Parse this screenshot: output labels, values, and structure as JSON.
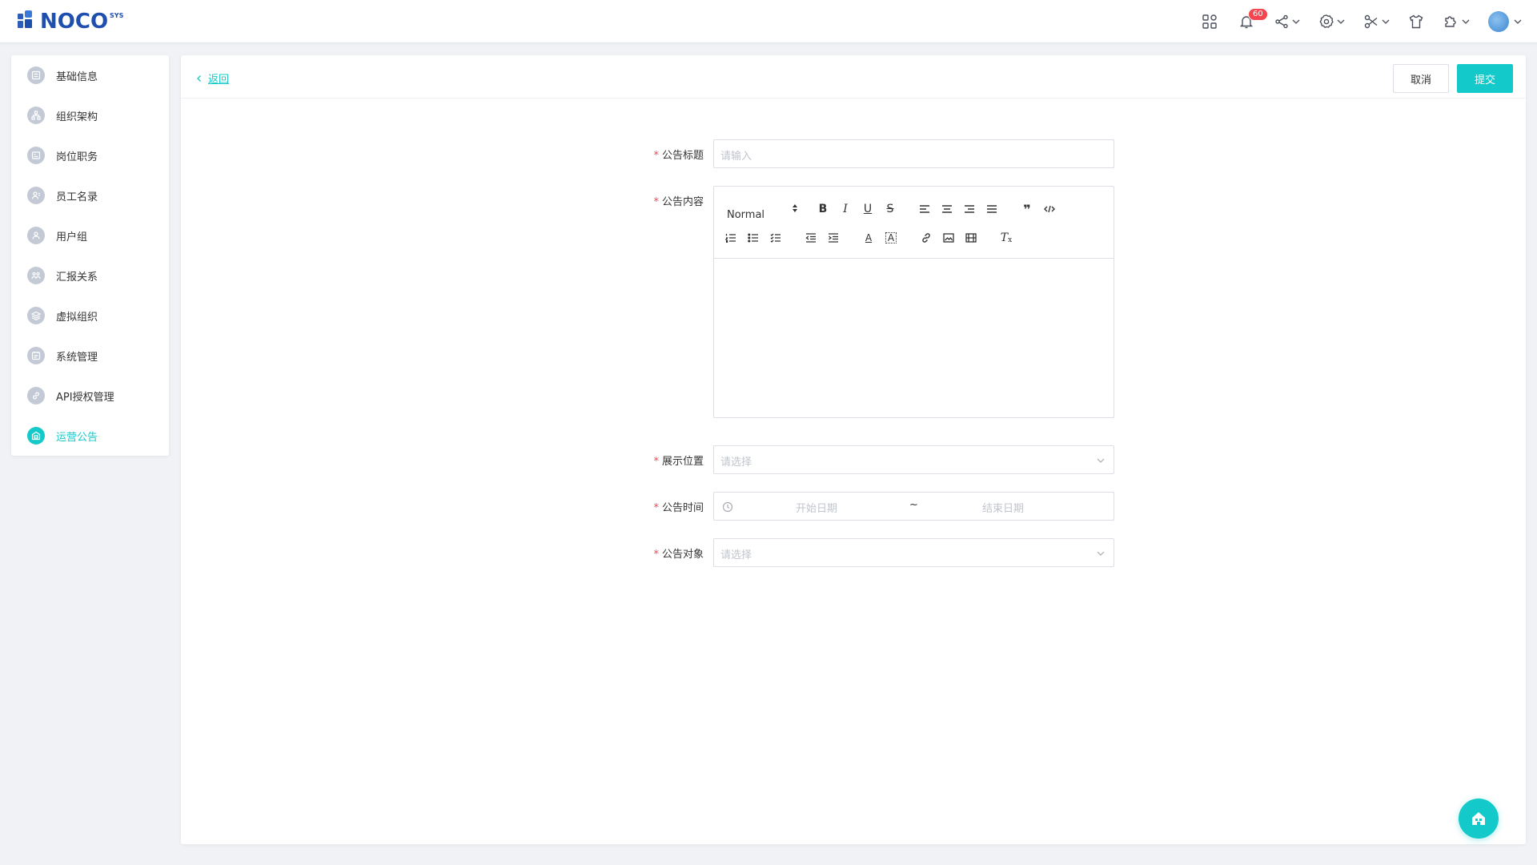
{
  "app": {
    "logo_text": "NOCO",
    "logo_sup": "SYS"
  },
  "header": {
    "notification_count": "60",
    "icons": [
      "apps-icon",
      "bell-icon",
      "share-icon",
      "settings-icon",
      "tools-icon",
      "shirt-icon",
      "plugin-icon",
      "avatar"
    ]
  },
  "sidebar": {
    "items": [
      {
        "label": "基础信息",
        "icon": "info-icon"
      },
      {
        "label": "组织架构",
        "icon": "org-icon"
      },
      {
        "label": "岗位职务",
        "icon": "position-icon"
      },
      {
        "label": "员工名录",
        "icon": "employee-icon"
      },
      {
        "label": "用户组",
        "icon": "user-group-icon"
      },
      {
        "label": "汇报关系",
        "icon": "report-icon"
      },
      {
        "label": "虚拟组织",
        "icon": "layers-icon"
      },
      {
        "label": "系统管理",
        "icon": "system-icon"
      },
      {
        "label": "API授权管理",
        "icon": "link-icon"
      },
      {
        "label": "运营公告",
        "icon": "announcement-icon",
        "active": true
      }
    ]
  },
  "main": {
    "back_label": "返回",
    "cancel_label": "取消",
    "submit_label": "提交"
  },
  "form": {
    "title_label": "公告标题",
    "title_placeholder": "请输入",
    "content_label": "公告内容",
    "editor_header_select": "Normal",
    "position_label": "展示位置",
    "position_placeholder": "请选择",
    "time_label": "公告时间",
    "time_start_placeholder": "开始日期",
    "time_separator": "~",
    "time_end_placeholder": "结束日期",
    "target_label": "公告对象",
    "target_placeholder": "请选择"
  },
  "colors": {
    "accent": "#14c9c9",
    "brand": "#1e4fae",
    "required": "#f5454f",
    "badge": "#f5454f"
  }
}
